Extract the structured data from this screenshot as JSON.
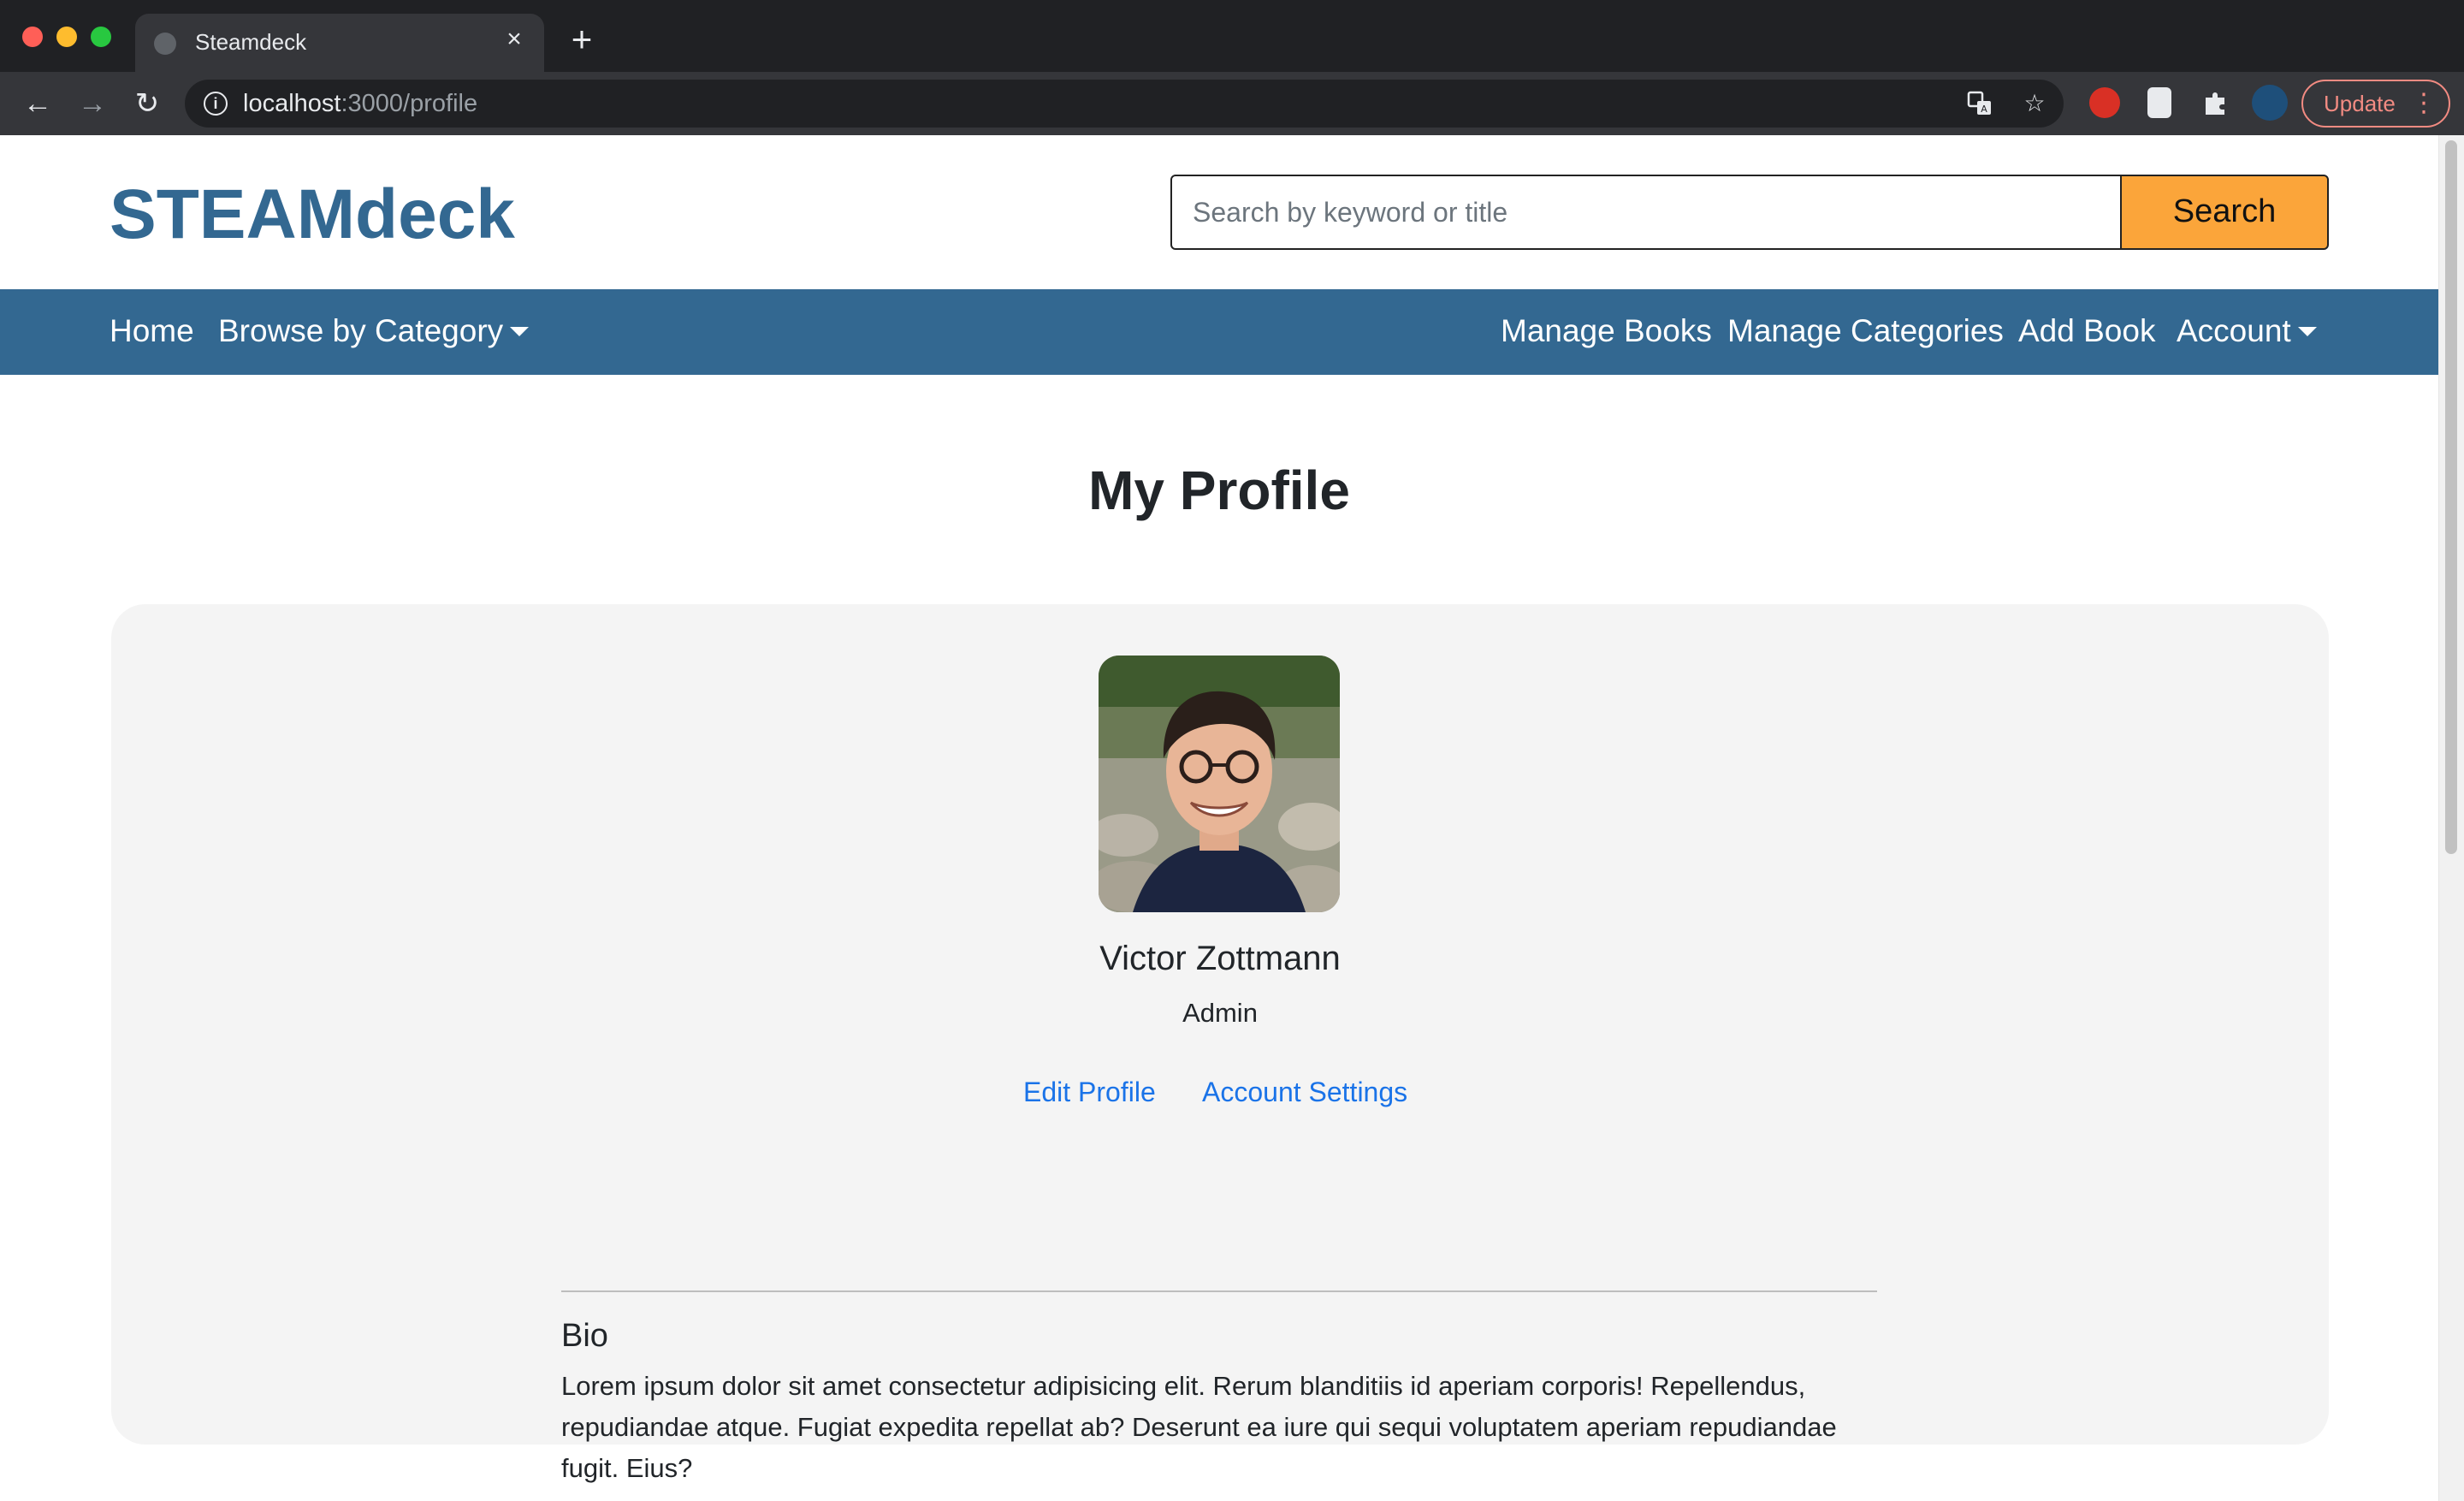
{
  "browser": {
    "tab_title": "Steamdeck",
    "url_host": "localhost",
    "url_path": ":3000/profile",
    "update_label": "Update"
  },
  "header": {
    "brand": "STEAMdeck",
    "search_placeholder": "Search by keyword or title",
    "search_button": "Search"
  },
  "nav": {
    "home": "Home",
    "browse": "Browse by Category",
    "manage_books": "Manage Books",
    "manage_categories": "Manage Categories",
    "add_book": "Add Book",
    "account": "Account"
  },
  "main": {
    "title": "My Profile"
  },
  "profile": {
    "name": "Victor Zottmann",
    "role": "Admin",
    "edit_profile": "Edit Profile",
    "account_settings": "Account Settings",
    "bio_title": "Bio",
    "bio_text": "Lorem ipsum dolor sit amet consectetur adipisicing elit. Rerum blanditiis id aperiam corporis! Repellendus, repudiandae atque. Fugiat expedita repellat ab? Deserunt ea iure qui sequi voluptatem aperiam repudiandae fugit. Eius?"
  },
  "colors": {
    "brand": "#336891",
    "search_button": "#fba53a",
    "link": "#1a73e8",
    "card": "#f4f4f4"
  }
}
